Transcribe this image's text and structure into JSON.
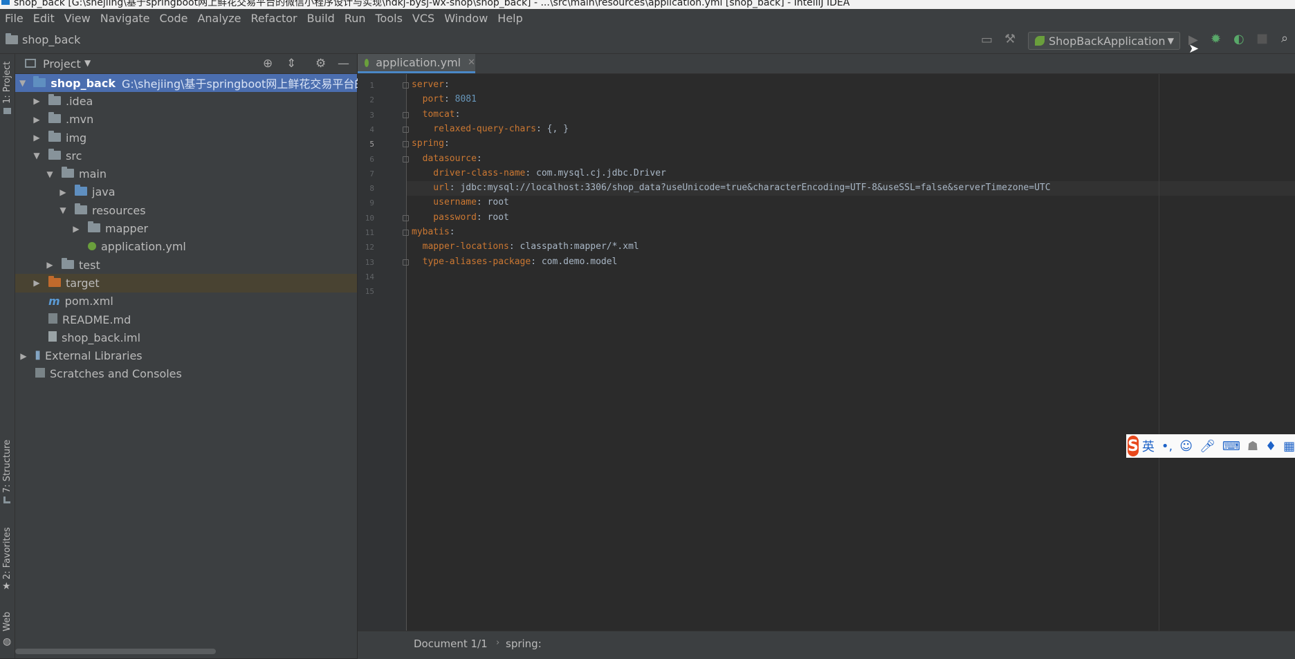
{
  "window": {
    "title": "shop_back [G:\\shejiing\\基于springboot网上鲜花交易平台的微信小程序设计与实现\\hdkj-bysj-wx-shop\\shop_back] - ...\\src\\main\\resources\\application.yml [shop_back] - IntelliJ IDEA"
  },
  "menu": [
    "File",
    "Edit",
    "View",
    "Navigate",
    "Code",
    "Analyze",
    "Refactor",
    "Build",
    "Run",
    "Tools",
    "VCS",
    "Window",
    "Help"
  ],
  "navbar": {
    "project": "shop_back",
    "run_config": "ShopBackApplication"
  },
  "left_strip": {
    "tabs": [
      "1: Project",
      "7: Structure",
      "2: Favorites",
      "Web"
    ]
  },
  "project_panel": {
    "title": "Project",
    "tree": [
      {
        "label": "shop_back",
        "path": "G:\\shejiing\\基于springboot网上鲜花交易平台的微信",
        "level": 0,
        "expand": "open",
        "icon": "module-folder-icon"
      },
      {
        "label": ".idea",
        "level": 1,
        "expand": "closed",
        "icon": "folder-icon"
      },
      {
        "label": ".mvn",
        "level": 1,
        "expand": "closed",
        "icon": "folder-icon"
      },
      {
        "label": "img",
        "level": 1,
        "expand": "closed",
        "icon": "folder-icon"
      },
      {
        "label": "src",
        "level": 1,
        "expand": "open",
        "icon": "folder-icon"
      },
      {
        "label": "main",
        "level": 2,
        "expand": "open",
        "icon": "folder-icon"
      },
      {
        "label": "java",
        "level": 3,
        "expand": "closed",
        "icon": "source-folder-icon"
      },
      {
        "label": "resources",
        "level": 3,
        "expand": "open",
        "icon": "resources-folder-icon"
      },
      {
        "label": "mapper",
        "level": 4,
        "expand": "closed",
        "icon": "package-folder-icon"
      },
      {
        "label": "application.yml",
        "level": 4,
        "expand": "none",
        "icon": "spring-yml-icon"
      },
      {
        "label": "test",
        "level": 2,
        "expand": "closed",
        "icon": "folder-icon"
      },
      {
        "label": "target",
        "level": 1,
        "expand": "closed",
        "icon": "excluded-folder-icon"
      },
      {
        "label": "pom.xml",
        "level": 1,
        "expand": "none",
        "icon": "maven-icon"
      },
      {
        "label": "README.md",
        "level": 1,
        "expand": "none",
        "icon": "markdown-icon"
      },
      {
        "label": "shop_back.iml",
        "level": 1,
        "expand": "none",
        "icon": "iml-file-icon"
      },
      {
        "label": "External Libraries",
        "level": 0,
        "expand": "closed",
        "icon": "libraries-icon"
      },
      {
        "label": "Scratches and Consoles",
        "level": 0,
        "expand": "none",
        "icon": "scratches-icon"
      }
    ]
  },
  "editor": {
    "tab": "application.yml",
    "current_line": 5,
    "lines": [
      [
        {
          "t": "server",
          "c": "k"
        },
        {
          "t": ":",
          "c": "v"
        }
      ],
      [
        {
          "t": "  port",
          "c": "k"
        },
        {
          "t": ": ",
          "c": "v"
        },
        {
          "t": "8081",
          "c": "n"
        }
      ],
      [
        {
          "t": "  tomcat",
          "c": "k"
        },
        {
          "t": ":",
          "c": "v"
        }
      ],
      [
        {
          "t": "    relaxed-query-chars",
          "c": "k"
        },
        {
          "t": ": {, }",
          "c": "v"
        }
      ],
      [
        {
          "t": "spring",
          "c": "k"
        },
        {
          "t": ":",
          "c": "v"
        }
      ],
      [
        {
          "t": "  datasource",
          "c": "k"
        },
        {
          "t": ":",
          "c": "v"
        }
      ],
      [
        {
          "t": "    driver-class-name",
          "c": "k"
        },
        {
          "t": ": com.mysql.cj.jdbc.Driver",
          "c": "v"
        }
      ],
      [
        {
          "t": "    url",
          "c": "k"
        },
        {
          "t": ": jdbc:mysql://localhost:3306/shop_data?useUnicode=true&characterEncoding=UTF-8&useSSL=false&serverTimezone=UTC",
          "c": "v"
        }
      ],
      [
        {
          "t": "    username",
          "c": "k"
        },
        {
          "t": ": root",
          "c": "v"
        }
      ],
      [
        {
          "t": "    password",
          "c": "k"
        },
        {
          "t": ": root",
          "c": "v"
        }
      ],
      [
        {
          "t": "mybatis",
          "c": "k"
        },
        {
          "t": ":",
          "c": "v"
        }
      ],
      [
        {
          "t": "  mapper-locations",
          "c": "k"
        },
        {
          "t": ": classpath:mapper/*.xml",
          "c": "v"
        }
      ],
      [
        {
          "t": "  type-aliases-package",
          "c": "k"
        },
        {
          "t": ": com.demo.model",
          "c": "v"
        }
      ],
      [],
      []
    ]
  },
  "status": {
    "doc": "Document 1/1",
    "path": "spring:"
  },
  "ime": {
    "mode": "英",
    "punct": "•,"
  }
}
